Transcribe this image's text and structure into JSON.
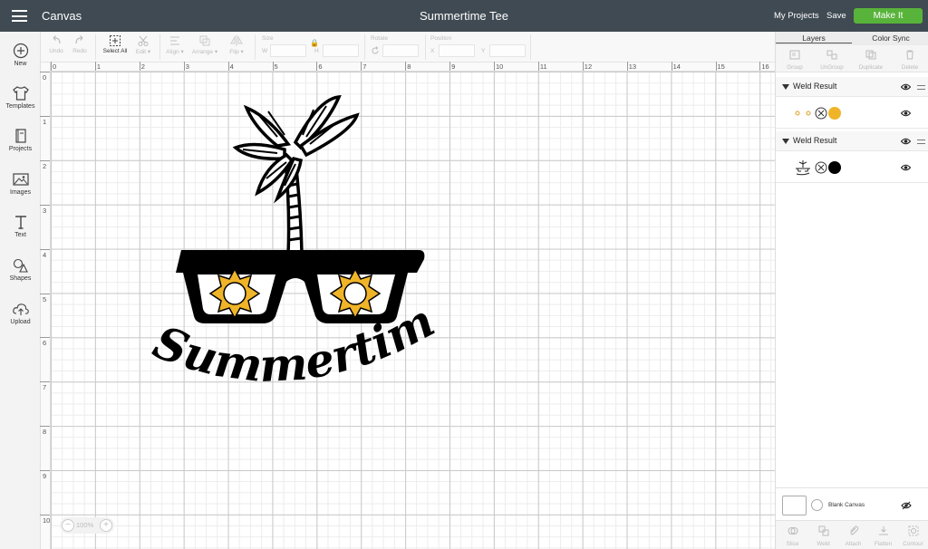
{
  "header": {
    "app_title": "Canvas",
    "document_title": "Summertime Tee",
    "my_projects": "My Projects",
    "save": "Save",
    "make_it": "Make It"
  },
  "sidebar": {
    "items": [
      {
        "label": "New",
        "icon": "plus-circle-icon"
      },
      {
        "label": "Templates",
        "icon": "tshirt-icon"
      },
      {
        "label": "Projects",
        "icon": "book-icon"
      },
      {
        "label": "Images",
        "icon": "image-icon"
      },
      {
        "label": "Text",
        "icon": "text-icon"
      },
      {
        "label": "Shapes",
        "icon": "shapes-icon"
      },
      {
        "label": "Upload",
        "icon": "cloud-upload-icon"
      }
    ]
  },
  "toolbar": {
    "undo": "Undo",
    "redo": "Redo",
    "select_all": "Select All",
    "edit": "Edit",
    "align": "Align",
    "arrange": "Arrange",
    "flip": "Flip",
    "size": "Size",
    "w": "W",
    "h": "H",
    "rotate": "Rotate",
    "position": "Position",
    "x": "X",
    "y": "Y"
  },
  "rulers": {
    "horizontal": [
      "0",
      "1",
      "2",
      "3",
      "4",
      "5",
      "6",
      "7",
      "8",
      "9",
      "10",
      "11",
      "12",
      "13",
      "14",
      "15",
      "16"
    ],
    "vertical": [
      "0",
      "1",
      "2",
      "3",
      "4",
      "5",
      "6",
      "7",
      "8",
      "9",
      "10"
    ]
  },
  "zoom": {
    "minus": "−",
    "value": "100%",
    "plus": "+"
  },
  "design": {
    "text": "Summertime",
    "colors": {
      "ink": "#000000",
      "sun": "#f0b429"
    }
  },
  "panel": {
    "tabs": [
      "Layers",
      "Color Sync"
    ],
    "actions": [
      "Group",
      "UnGroup",
      "Duplicate",
      "Delete"
    ],
    "layers": [
      {
        "name": "Weld Result",
        "swatch": "#f0b429"
      },
      {
        "name": "Weld Result",
        "swatch": "#000000"
      }
    ],
    "blank_canvas": "Blank Canvas",
    "bottom_actions": [
      "Slice",
      "Weld",
      "Attach",
      "Flatten",
      "Contour"
    ]
  }
}
